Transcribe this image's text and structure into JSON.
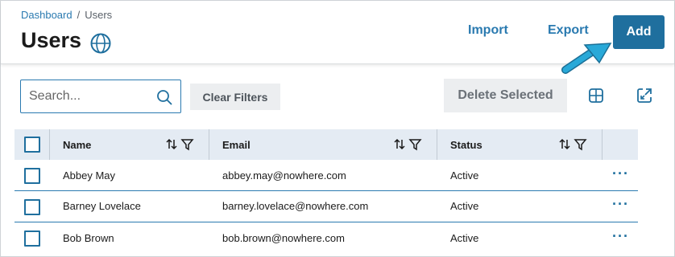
{
  "breadcrumb": {
    "root": "Dashboard",
    "separator": "/",
    "current": "Users"
  },
  "page": {
    "title": "Users"
  },
  "header_actions": {
    "import_label": "Import",
    "export_label": "Export",
    "add_label": "Add"
  },
  "toolbar": {
    "search_placeholder": "Search...",
    "search_value": "",
    "clear_filters_label": "Clear Filters",
    "delete_selected_label": "Delete Selected"
  },
  "table": {
    "columns": [
      "Name",
      "Email",
      "Status"
    ],
    "rows": [
      {
        "name": "Abbey May",
        "email": "abbey.may@nowhere.com",
        "status": "Active"
      },
      {
        "name": "Barney Lovelace",
        "email": "barney.lovelace@nowhere.com",
        "status": "Active"
      },
      {
        "name": "Bob Brown",
        "email": "bob.brown@nowhere.com",
        "status": "Active"
      }
    ],
    "row_menu_label": "···"
  },
  "icons": {
    "page_title_icon": "globe-icon",
    "search_icon": "search-icon",
    "column_settings_icon": "grid-icon",
    "expand_icon": "expand-icon",
    "sort_icon": "sort-icon",
    "filter_icon": "filter-icon",
    "pointer": "arrow-pointer-icon"
  },
  "colors": {
    "accent": "#1f6f9e",
    "link": "#2a7ab0",
    "header_row_bg": "#e4ebf3",
    "arrow": "#29a9d8"
  }
}
